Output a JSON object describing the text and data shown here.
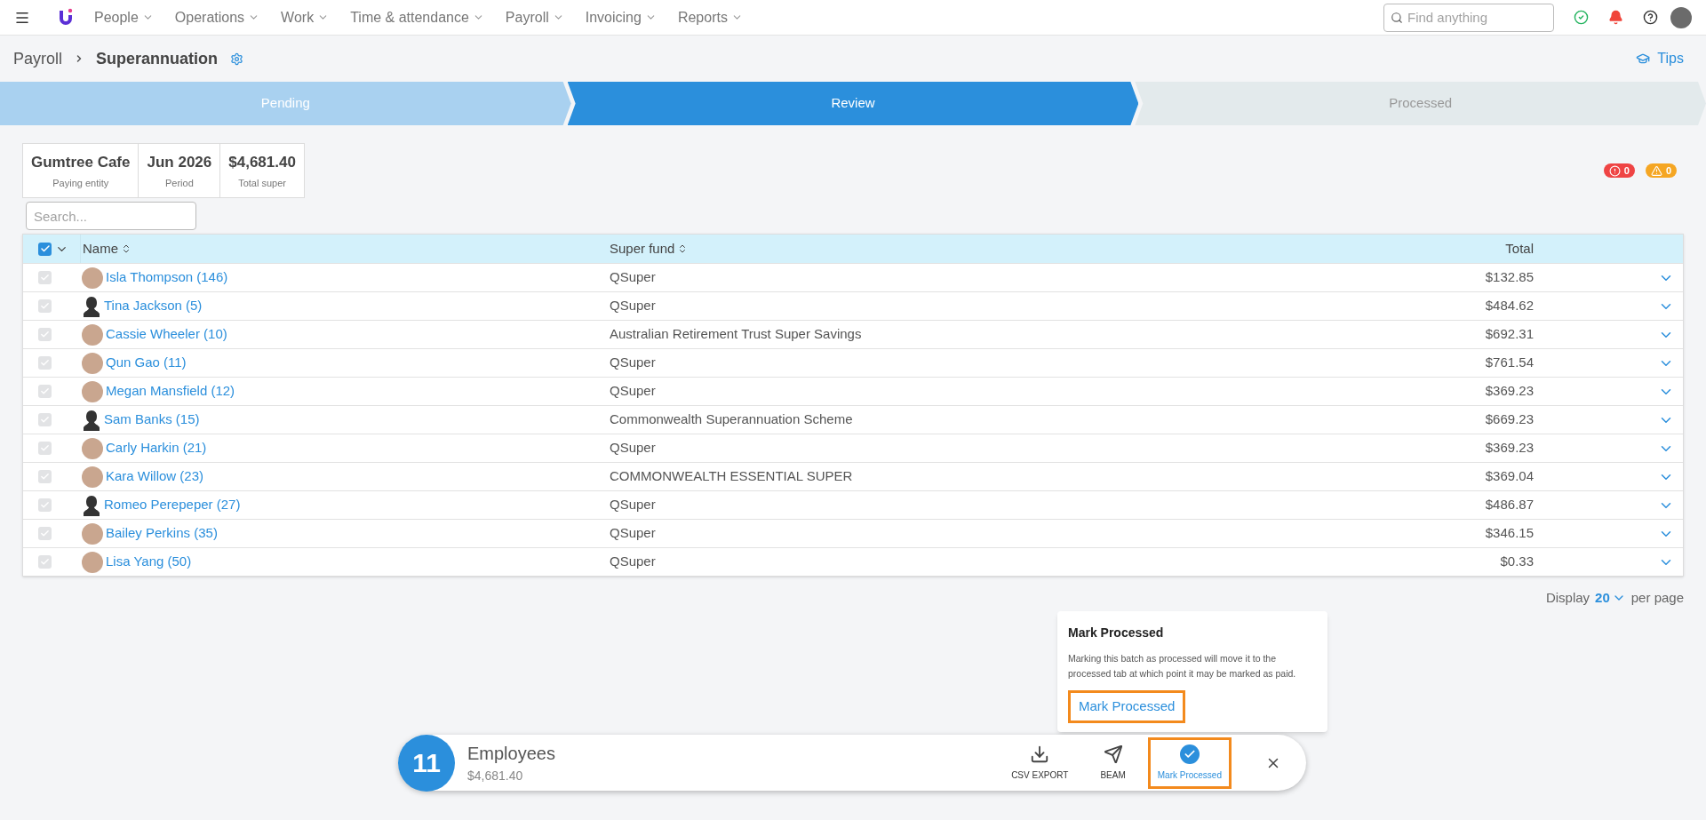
{
  "nav": {
    "menu": [
      {
        "label": "People"
      },
      {
        "label": "Operations"
      },
      {
        "label": "Work"
      },
      {
        "label": "Time & attendance"
      },
      {
        "label": "Payroll"
      },
      {
        "label": "Invoicing"
      },
      {
        "label": "Reports"
      }
    ],
    "search": {
      "placeholder": "Find anything"
    }
  },
  "breadcrumb": {
    "parent": "Payroll",
    "current": "Superannuation",
    "tips": "Tips"
  },
  "steps": [
    {
      "label": "Pending",
      "kind": "done"
    },
    {
      "label": "Review",
      "kind": "active"
    },
    {
      "label": "Processed",
      "kind": "todo"
    }
  ],
  "summary": [
    {
      "value": "Gumtree Cafe",
      "label": "Paying entity"
    },
    {
      "value": "Jun 2026",
      "label": "Period"
    },
    {
      "value": "$4,681.40",
      "label": "Total super"
    }
  ],
  "alerts": [
    {
      "kind": "error",
      "count": "0",
      "color": "#ef4444"
    },
    {
      "kind": "warning",
      "count": "0",
      "color": "#f5a623"
    }
  ],
  "search": {
    "placeholder": "Search..."
  },
  "table": {
    "select_all": {
      "checked": true
    },
    "columns": [
      "Name",
      "Super fund",
      "Total"
    ],
    "rows": [
      {
        "name": "Isla Thompson (146)",
        "fund": "QSuper",
        "total": "$132.85",
        "kind": "photo",
        "checked": true
      },
      {
        "name": "Tina Jackson (5)",
        "fund": "QSuper",
        "total": "$484.62",
        "kind": "silhouette",
        "checked": true
      },
      {
        "name": "Cassie Wheeler (10)",
        "fund": "Australian Retirement Trust Super Savings",
        "total": "$692.31",
        "kind": "photo",
        "checked": true
      },
      {
        "name": "Qun Gao (11)",
        "fund": "QSuper",
        "total": "$761.54",
        "kind": "photo",
        "checked": true
      },
      {
        "name": "Megan Mansfield (12)",
        "fund": "QSuper",
        "total": "$369.23",
        "kind": "photo",
        "checked": true
      },
      {
        "name": "Sam Banks (15)",
        "fund": "Commonwealth Superannuation Scheme",
        "total": "$669.23",
        "kind": "silhouette",
        "checked": true
      },
      {
        "name": "Carly Harkin (21)",
        "fund": "QSuper",
        "total": "$369.23",
        "kind": "photo",
        "checked": true
      },
      {
        "name": "Kara Willow (23)",
        "fund": "COMMONWEALTH ESSENTIAL SUPER",
        "total": "$369.04",
        "kind": "photo",
        "checked": true
      },
      {
        "name": "Romeo Perepeper (27)",
        "fund": "QSuper",
        "total": "$486.87",
        "kind": "silhouette",
        "checked": true
      },
      {
        "name": "Bailey Perkins (35)",
        "fund": "QSuper",
        "total": "$346.15",
        "kind": "photo",
        "checked": true
      },
      {
        "name": "Lisa Yang (50)",
        "fund": "QSuper",
        "total": "$0.33",
        "kind": "photo",
        "checked": true
      }
    ]
  },
  "pagination": {
    "prefix": "Display",
    "value": "20",
    "suffix": "per page"
  },
  "popover": {
    "title": "Mark Processed",
    "text": "Marking this batch as processed will move it to the processed tab at which point it may be marked as paid.",
    "action": "Mark Processed",
    "highlighted": true
  },
  "action_bar": {
    "count": "11",
    "title": "Employees",
    "amount": "$4,681.40",
    "actions": [
      {
        "kind": "download",
        "label": "CSV EXPORT",
        "highlighted": false
      },
      {
        "kind": "send",
        "label": "BEAM",
        "highlighted": false
      },
      {
        "kind": "check",
        "label": "Mark Processed",
        "highlighted": true
      }
    ]
  }
}
